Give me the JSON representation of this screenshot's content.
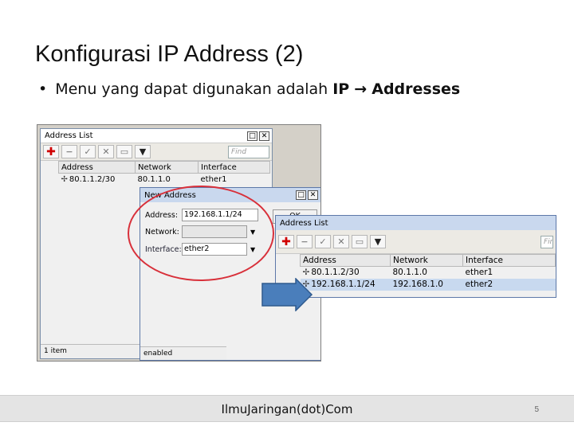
{
  "slide": {
    "title": "Konfigurasi IP Address (2)",
    "bullet_prefix": "Menu yang dapat digunakan adalah ",
    "bullet_ip": "IP",
    "bullet_arrow": "→",
    "bullet_target": "Addresses"
  },
  "address_list_back": {
    "title": "Address List",
    "find_placeholder": "Find",
    "columns": [
      "Address",
      "Network",
      "Interface"
    ],
    "rows": [
      {
        "address": "80.1.1.2/30",
        "network": "80.1.1.0",
        "interface": "ether1"
      }
    ],
    "status": "1 item"
  },
  "new_address": {
    "title": "New Address",
    "address_label": "Address:",
    "address_value": "192.168.1.1/24",
    "network_label": "Network:",
    "network_value": "",
    "interface_label": "Interface:",
    "interface_value": "ether2",
    "ok_label": "OK",
    "status": "enabled"
  },
  "address_list_front": {
    "title": "Address List",
    "find_placeholder": "Find",
    "columns": [
      "Address",
      "Network",
      "Interface"
    ],
    "rows": [
      {
        "address": "80.1.1.2/30",
        "network": "80.1.1.0",
        "interface": "ether1"
      },
      {
        "address": "192.168.1.1/24",
        "network": "192.168.1.0",
        "interface": "ether2"
      }
    ]
  },
  "footer": {
    "site": "IlmuJaringan(dot)Com",
    "page": "5"
  },
  "colors": {
    "annotation_ellipse": "#d8303a",
    "arrow_fill": "#4a7ebb",
    "titlebar_blue": "#c9d8ee"
  }
}
